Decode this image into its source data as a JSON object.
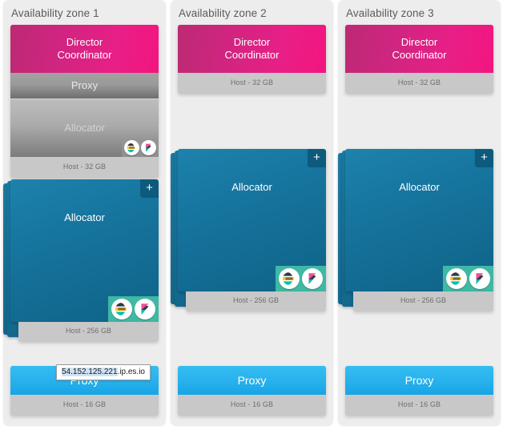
{
  "colors": {
    "page_background": "#ffffff",
    "zone_panel": "#ededed",
    "director_accent": "#e81f86",
    "allocator_accent": "#15729b",
    "proxy_accent": "#27b0ec",
    "host_bar": "#c8c8c8",
    "logo_badge": "#3fb8a4",
    "plus_button": "#0d5a7c",
    "disabled_node": "#9a9a9a"
  },
  "labels": {
    "director": "Director\nCoordinator",
    "proxy": "Proxy",
    "allocator": "Allocator",
    "host_32": "Host - 32 GB",
    "host_256": "Host - 256 GB",
    "host_16": "Host - 16 GB",
    "plus": "+"
  },
  "icons": {
    "elasticsearch": "elasticsearch-logo-icon",
    "kibana": "kibana-logo-icon",
    "add": "plus-icon"
  },
  "tooltip": {
    "visible": true,
    "selected_text": "54.152.125.221",
    "suffix_text": ".ip.es.io",
    "full_text": "54.152.125.221.ip.es.io"
  },
  "zones": [
    {
      "title": "Availability zone 1",
      "director": {
        "label": "Director\nCoordinator",
        "host": "Host - 32 GB",
        "has_extra_nodes": true
      },
      "extra_nodes": [
        {
          "label": "Proxy",
          "state": "disabled"
        },
        {
          "label": "Allocator",
          "state": "disabled",
          "has_logos": true
        }
      ],
      "allocator": {
        "label": "Allocator",
        "host": "Host - 256 GB",
        "plus": "+",
        "has_logos": true
      },
      "proxy": {
        "label": "Proxy",
        "host": "Host - 16 GB",
        "has_tooltip": true
      }
    },
    {
      "title": "Availability zone 2",
      "director": {
        "label": "Director\nCoordinator",
        "host": "Host - 32 GB",
        "has_extra_nodes": false
      },
      "extra_nodes": [],
      "allocator": {
        "label": "Allocator",
        "host": "Host - 256 GB",
        "plus": "+",
        "has_logos": true
      },
      "proxy": {
        "label": "Proxy",
        "host": "Host - 16 GB",
        "has_tooltip": false
      }
    },
    {
      "title": "Availability zone 3",
      "director": {
        "label": "Director\nCoordinator",
        "host": "Host - 32 GB",
        "has_extra_nodes": false
      },
      "extra_nodes": [],
      "allocator": {
        "label": "Allocator",
        "host": "Host - 256 GB",
        "plus": "+",
        "has_logos": true
      },
      "proxy": {
        "label": "Proxy",
        "host": "Host - 16 GB",
        "has_tooltip": false
      }
    }
  ]
}
